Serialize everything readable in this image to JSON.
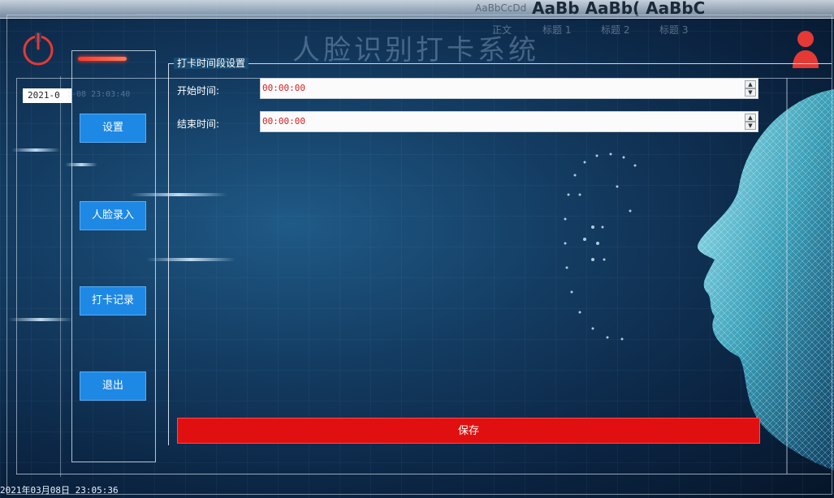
{
  "app": {
    "title": "人脸识别打卡系统"
  },
  "background_ribbon": {
    "style_sample": "AaBbCcDd",
    "style_big": "AaBb AaBb( AaBbC",
    "style_normal": "正文",
    "heading1": "标题 1",
    "heading2": "标题 2",
    "heading3": "标题 3"
  },
  "datetime_top": "2021-0",
  "datetime_top_ghost": "3-08 23:03:40",
  "datetime_bottom": "2021年03月08日 23:05:36",
  "nav": {
    "settings": "设置",
    "face_enroll": "人脸录入",
    "records": "打卡记录",
    "exit": "退出"
  },
  "settings": {
    "group_title": "打卡时间段设置",
    "start_label": "开始时间:",
    "start_value": "00:00:00",
    "end_label": "结束时间:",
    "end_value": "00:00:00",
    "save_label": "保存"
  },
  "colors": {
    "nav_button": "#1e88e5",
    "save_button": "#e01010",
    "time_value_text": "#d42020",
    "power_icon": "#e53935",
    "user_icon": "#e53935"
  },
  "icons": {
    "power": "power-icon",
    "user": "user-icon",
    "spin_up": "spin-up-arrow-icon",
    "spin_down": "spin-down-arrow-icon"
  }
}
